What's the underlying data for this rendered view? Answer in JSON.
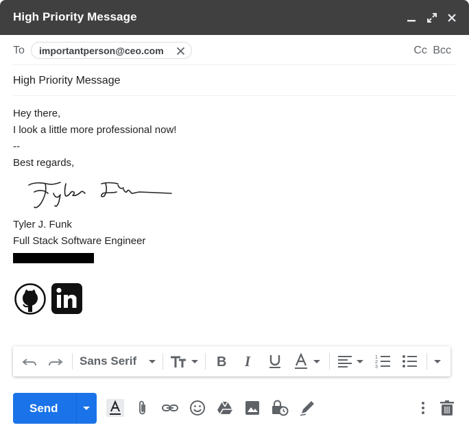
{
  "window": {
    "title": "High Priority Message"
  },
  "to": {
    "label": "To",
    "recipients": [
      "importantperson@ceo.com"
    ],
    "cc_bcc": "Cc Bcc"
  },
  "subject": "High Priority Message",
  "body": {
    "lines": [
      "Hey there,",
      "I look a little more professional now!",
      "--",
      "Best regards,"
    ],
    "signature_name": "Tyler J. Funk",
    "signature_title": "Full Stack Software Engineer"
  },
  "toolbar": {
    "font": "Sans Serif"
  },
  "actions": {
    "send_label": "Send"
  },
  "colors": {
    "header": "#404040",
    "send": "#1a73e8",
    "icon": "#5f6368"
  }
}
